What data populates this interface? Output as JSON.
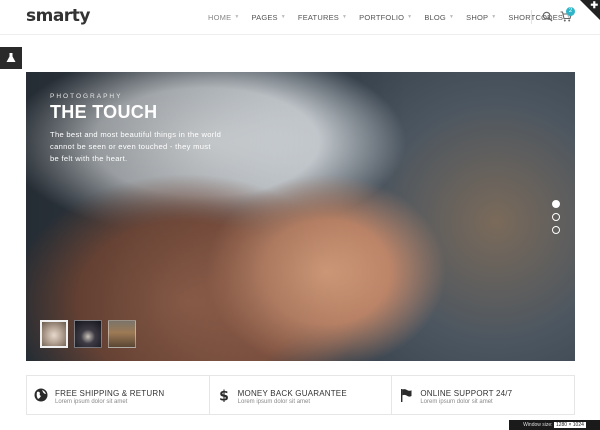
{
  "header": {
    "logo": "smarty",
    "nav": [
      {
        "label": "HOME",
        "active": true
      },
      {
        "label": "PAGES"
      },
      {
        "label": "FEATURES"
      },
      {
        "label": "PORTFOLIO"
      },
      {
        "label": "BLOG"
      },
      {
        "label": "SHOP"
      },
      {
        "label": "SHORTCODES"
      }
    ],
    "cart_count": "2"
  },
  "hero": {
    "kicker": "PHOTOGRAPHY",
    "title": "THE TOUCH",
    "description": "The best and most beautiful things in the world cannot be seen or even touched - they must be felt with the heart."
  },
  "features": [
    {
      "icon": "globe-icon",
      "title": "FREE SHIPPING & RETURN",
      "subtitle": "Lorem ipsum dolor sit amet"
    },
    {
      "icon": "dollar-icon",
      "title": "MONEY BACK GUARANTEE",
      "subtitle": "Lorem ipsum dolor sit amet"
    },
    {
      "icon": "flag-icon",
      "title": "ONLINE SUPPORT 24/7",
      "subtitle": "Lorem ipsum dolor sit amet"
    }
  ],
  "window_size": {
    "label": "Window size:",
    "value": "1280 × 1024"
  },
  "colors": {
    "accent": "#2fb5c7",
    "dark": "#2a2a2a"
  }
}
